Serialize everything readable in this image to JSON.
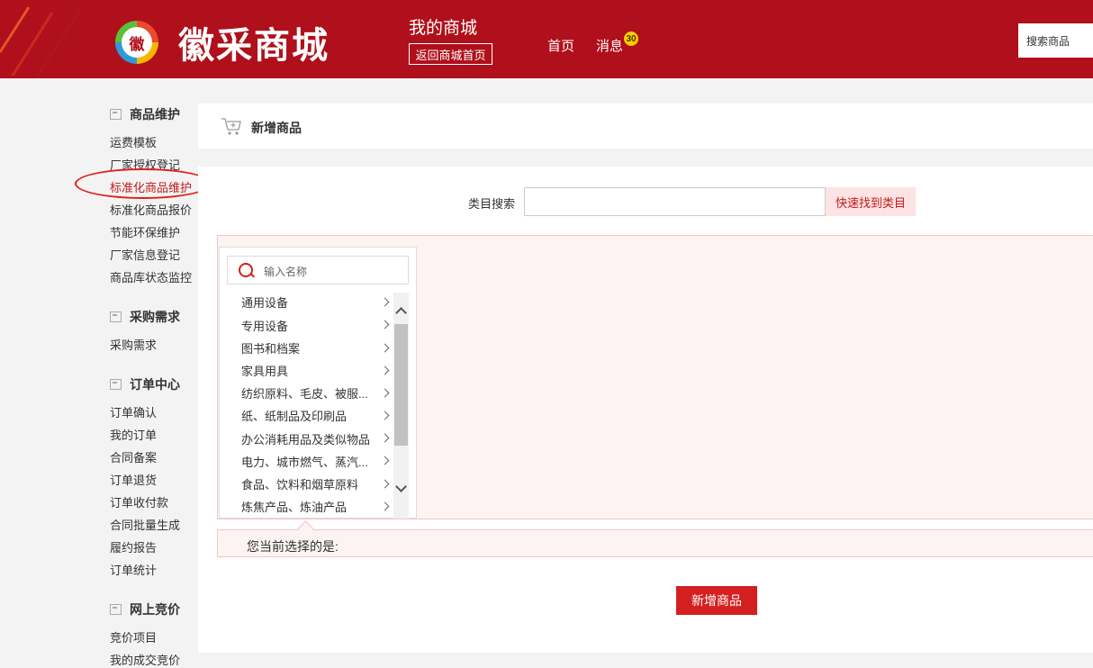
{
  "header": {
    "logo_char": "徽",
    "logo_text": "徽采商城",
    "mall_title": "我的商城",
    "back_label": "返回商城首页",
    "nav_home": "首页",
    "nav_messages": "消息",
    "message_count": "30",
    "search_label": "搜索商品"
  },
  "sidebar": {
    "sections": [
      {
        "title": "商品维护",
        "items": [
          "运费模板",
          "厂家授权登记",
          "标准化商品维护",
          "标准化商品报价",
          "节能环保维护",
          "厂家信息登记",
          "商品库状态监控"
        ]
      },
      {
        "title": "采购需求",
        "items": [
          "采购需求"
        ]
      },
      {
        "title": "订单中心",
        "items": [
          "订单确认",
          "我的订单",
          "合同备案",
          "订单退货",
          "订单收付款",
          "合同批量生成",
          "履约报告",
          "订单统计"
        ]
      },
      {
        "title": "网上竞价",
        "items": [
          "竞价项目",
          "我的成交竞价"
        ]
      }
    ]
  },
  "main": {
    "page_title": "新增商品",
    "category_search_label": "类目搜索",
    "category_search_value": "",
    "quick_find_label": "快速找到类目",
    "tree_search_placeholder": "输入名称",
    "categories": [
      "通用设备",
      "专用设备",
      "图书和档案",
      "家具用具",
      "纺织原料、毛皮、被服...",
      "纸、纸制品及印刷品",
      "办公消耗用品及类似物品",
      "电力、城市燃气、蒸汽...",
      "食品、饮料和烟草原料",
      "炼焦产品、炼油产品"
    ],
    "current_selection_label": "您当前选择的是:",
    "add_button_label": "新增商品"
  },
  "colors": {
    "brand_red": "#b0101b",
    "accent_red": "#d42020",
    "light_pink": "#fdf3f3"
  }
}
